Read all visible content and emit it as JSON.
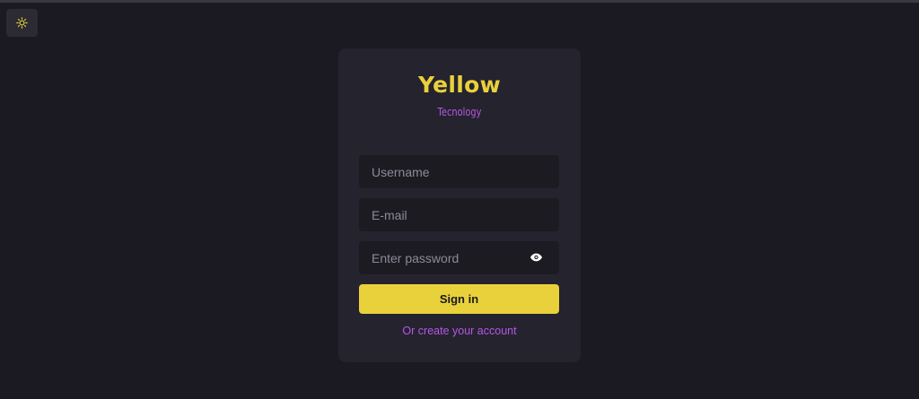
{
  "theme_toggle": {
    "icon": "sun-icon",
    "color": "#e9d13b"
  },
  "brand": {
    "title": "Yellow",
    "subtitle": "Tecnology",
    "title_color": "#e9d13b",
    "subtitle_color": "#b657e6"
  },
  "form": {
    "username_placeholder": "Username",
    "email_placeholder": "E-mail",
    "password_placeholder": "Enter password",
    "password_toggle_icon": "eye-icon",
    "signin_label": "Sign in",
    "create_account_label": "Or create your account"
  },
  "colors": {
    "background": "#1b1a22",
    "card": "#25232e",
    "input": "#1c1b22",
    "accent": "#e9d13b",
    "link": "#b657e6"
  }
}
